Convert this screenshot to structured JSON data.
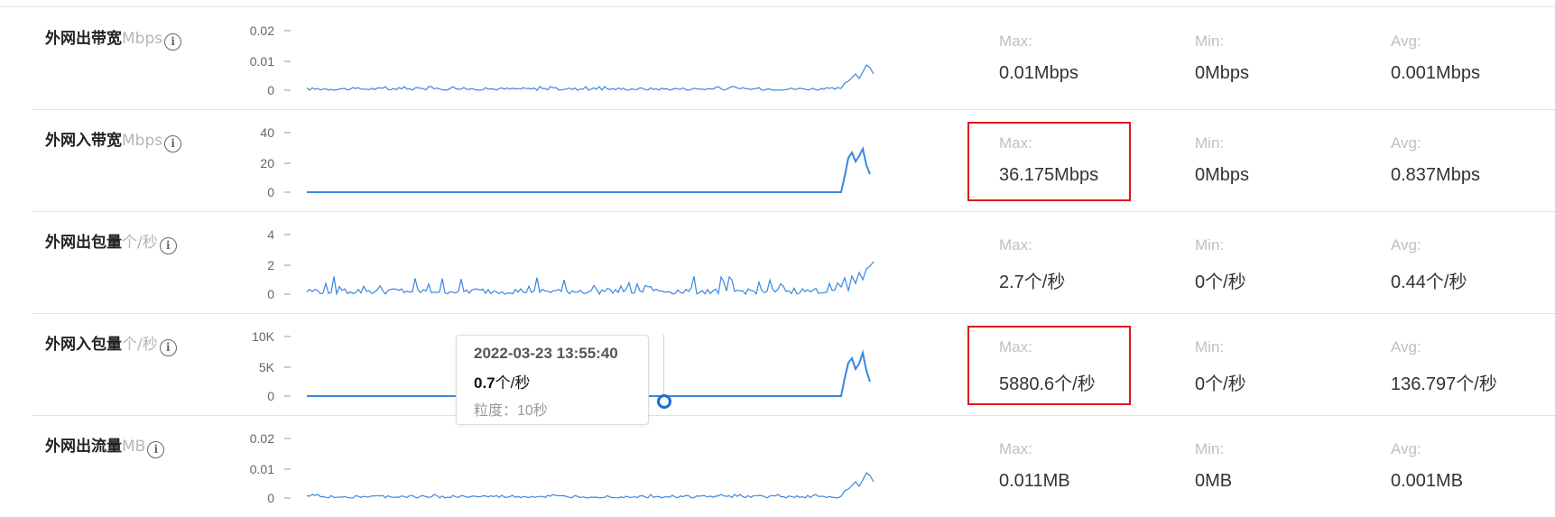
{
  "accent_color": "#3a86e0",
  "highlight_color": "#e0141e",
  "info_icon": "info-circle-icon",
  "stat_keys": {
    "max": "Max:",
    "min": "Min:",
    "avg": "Avg:"
  },
  "metrics": [
    {
      "name": "外网出带宽",
      "unit": "Mbps",
      "ticks": [
        "0.02",
        "0.01",
        "0"
      ],
      "max": "0.01Mbps",
      "min": "0Mbps",
      "avg": "0.001Mbps",
      "highlight_max": false
    },
    {
      "name": "外网入带宽",
      "unit": "Mbps",
      "ticks": [
        "40",
        "20",
        "0"
      ],
      "max": "36.175Mbps",
      "min": "0Mbps",
      "avg": "0.837Mbps",
      "highlight_max": true
    },
    {
      "name": "外网出包量",
      "unit": "个/秒",
      "ticks": [
        "4",
        "2",
        "0"
      ],
      "max": "2.7个/秒",
      "min": "0个/秒",
      "avg": "0.44个/秒",
      "highlight_max": false
    },
    {
      "name": "外网入包量",
      "unit": "个/秒",
      "ticks": [
        "10K",
        "5K",
        "0"
      ],
      "max": "5880.6个/秒",
      "min": "0个/秒",
      "avg": "136.797个/秒",
      "highlight_max": true
    },
    {
      "name": "外网出流量",
      "unit": "MB",
      "ticks": [
        "0.02",
        "0.01",
        "0"
      ],
      "max": "0.011MB",
      "min": "0MB",
      "avg": "0.001MB",
      "highlight_max": false
    }
  ],
  "tooltip": {
    "time": "2022-03-23 13:55:40",
    "value": "0.7",
    "value_unit": "个/秒",
    "granularity": "粒度：10秒"
  }
}
